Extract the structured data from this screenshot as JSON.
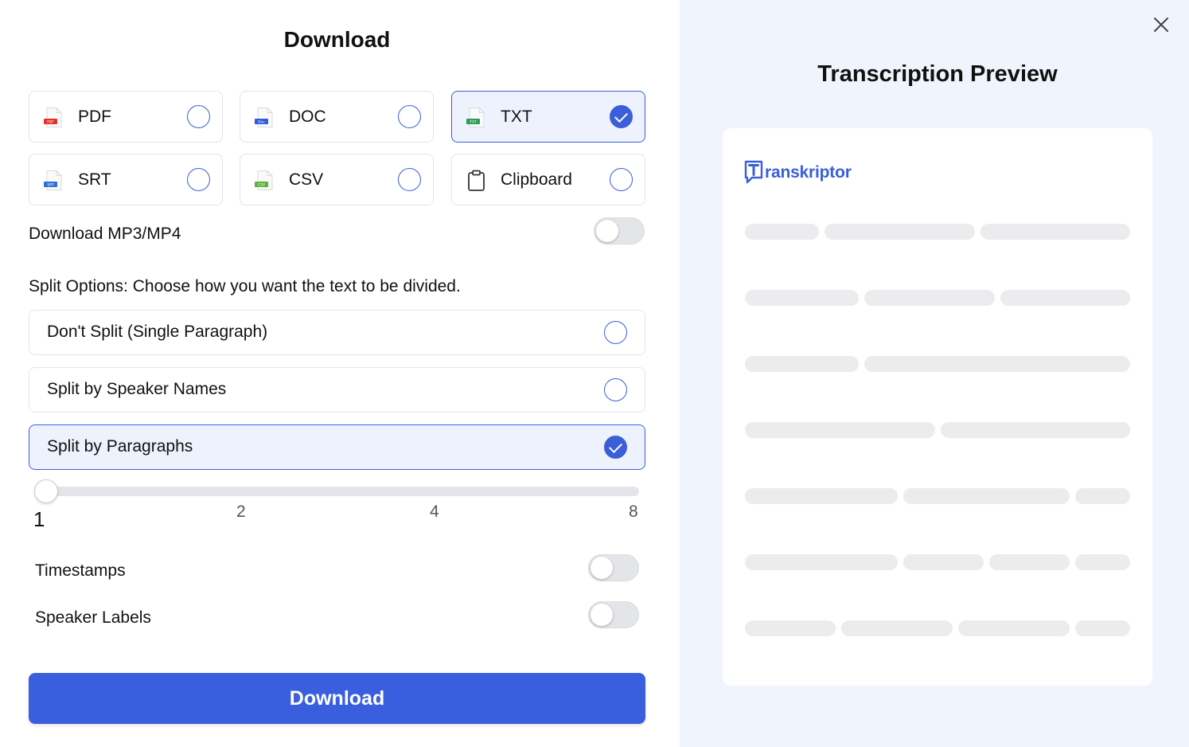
{
  "dialog": {
    "title": "Download",
    "close_icon": "close-icon"
  },
  "formats": [
    {
      "label": "PDF",
      "icon": "pdf-file-icon",
      "tag": "PDF",
      "color": "#e5302a",
      "selected": false
    },
    {
      "label": "DOC",
      "icon": "doc-file-icon",
      "tag": "Doc",
      "color": "#2f5bd8",
      "selected": false
    },
    {
      "label": "TXT",
      "icon": "txt-file-icon",
      "tag": "TXT",
      "color": "#2e9c5a",
      "selected": true
    },
    {
      "label": "SRT",
      "icon": "srt-file-icon",
      "tag": "SRT",
      "color": "#2f6fd8",
      "selected": false
    },
    {
      "label": "CSV",
      "icon": "csv-file-icon",
      "tag": "CSV",
      "color": "#5bb33a",
      "selected": false
    },
    {
      "label": "Clipboard",
      "icon": "clipboard-icon",
      "selected": false
    }
  ],
  "media_toggle": {
    "label": "Download MP3/MP4",
    "on": false
  },
  "split": {
    "heading": "Split Options: Choose how you want the text to be divided.",
    "options": [
      {
        "label": "Don't Split (Single Paragraph)",
        "selected": false
      },
      {
        "label": "Split by Speaker Names",
        "selected": false
      },
      {
        "label": "Split by Paragraphs",
        "selected": true
      }
    ],
    "slider": {
      "value": 1,
      "ticks": [
        "1",
        "2",
        "4",
        "8"
      ]
    }
  },
  "toggles": {
    "timestamps": {
      "label": "Timestamps",
      "on": false
    },
    "speaker_labels": {
      "label": "Speaker Labels",
      "on": false
    }
  },
  "download_button": "Download",
  "preview": {
    "title": "Transcription Preview",
    "logo_letter": "T",
    "logo_text": "ranskriptor"
  },
  "colors": {
    "accent": "#3a5fde",
    "preview_bg": "#f0f4fd",
    "placeholder": "#ececee"
  }
}
